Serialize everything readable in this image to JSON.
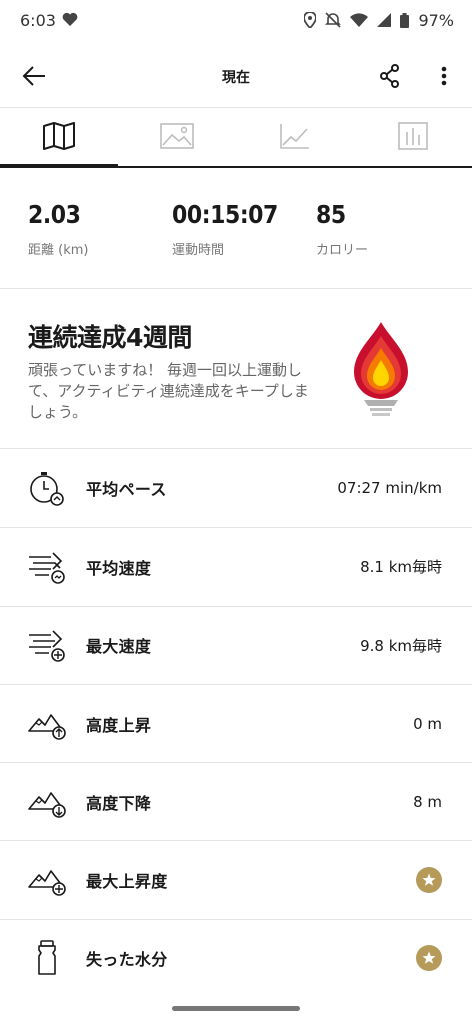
{
  "status_bar": {
    "time": "6:03",
    "battery": "97%",
    "icons": [
      "heart-icon",
      "location-icon",
      "mute-icon",
      "wifi-icon",
      "signal-icon",
      "battery-icon"
    ]
  },
  "app_bar": {
    "title": "現在",
    "icons": [
      "back-arrow-icon",
      "share-icon",
      "more-vert-icon"
    ]
  },
  "tabs": [
    {
      "name": "map",
      "icon": "map-icon",
      "active": true
    },
    {
      "name": "photos",
      "icon": "image-icon",
      "active": false
    },
    {
      "name": "graph",
      "icon": "line-chart-icon",
      "active": false
    },
    {
      "name": "stats",
      "icon": "bar-chart-icon",
      "active": false
    }
  ],
  "summary": {
    "distance": {
      "value": "2.03",
      "label": "距離 (km)"
    },
    "duration": {
      "value": "00:15:07",
      "label": "運動時間"
    },
    "calories": {
      "value": "85",
      "label": "カロリー"
    }
  },
  "streak": {
    "title": "連続達成4週間",
    "description": "頑張っていますね！ 毎週一回以上運動して、アクティビティ連続達成をキープしましょう。",
    "icon": "flame-trophy-icon"
  },
  "metrics": [
    {
      "label": "平均ペース",
      "value": "07:27 min/km",
      "icon": "stopwatch-icon"
    },
    {
      "label": "平均速度",
      "value": "8.1 km毎時",
      "icon": "speed-avg-icon"
    },
    {
      "label": "最大速度",
      "value": "9.8 km毎時",
      "icon": "speed-max-icon"
    },
    {
      "label": "高度上昇",
      "value": "0 m",
      "icon": "elevation-up-icon"
    },
    {
      "label": "高度下降",
      "value": "8 m",
      "icon": "elevation-down-icon"
    },
    {
      "label": "最大上昇度",
      "value": "",
      "icon": "elevation-max-icon",
      "premium": true
    },
    {
      "label": "失った水分",
      "value": "",
      "icon": "water-bottle-icon",
      "premium": true
    }
  ],
  "colors": {
    "accent_gold": "#b59a5a",
    "flame_red": "#c8102e",
    "flame_orange": "#f57c00",
    "flame_yellow": "#ffd600"
  }
}
